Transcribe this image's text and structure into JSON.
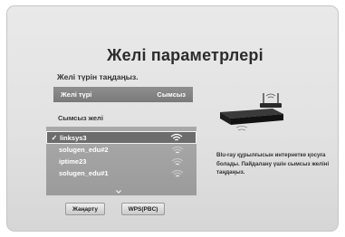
{
  "screen": {
    "title": "Желі параметрлері",
    "subtitle": "Желі түрін таңдаңыз."
  },
  "network_type": {
    "label": "Желі түрі",
    "value": "Сымсыз"
  },
  "wireless_section": {
    "label": "Сымсыз желі",
    "networks": [
      {
        "name": "linksys3",
        "selected": true,
        "checked": true,
        "signal": "strong"
      },
      {
        "name": "solugen_edu#2",
        "selected": false,
        "checked": false,
        "signal": "weak"
      },
      {
        "name": "iptime23",
        "selected": false,
        "checked": false,
        "signal": "weak"
      },
      {
        "name": "solugen_edu#1",
        "selected": false,
        "checked": false,
        "signal": "weak"
      }
    ],
    "check_glyph": "✓"
  },
  "buttons": {
    "refresh": "Жаңарту",
    "wps": "WPS(PBC)"
  },
  "description": "Blu-ray құрылғысын интернетке қосуға болады. Пайдалану үшін сымсыз желіні таңдаңыз.",
  "icons": {
    "wifi": "wifi-signal-icon",
    "scroll_down": "chevron-down-icon",
    "device": "blu-ray-player-router-icon"
  },
  "colors": {
    "selected_row": "#6c6c6c",
    "list_bg": "#a3a3a3",
    "header_row": "#858585"
  }
}
